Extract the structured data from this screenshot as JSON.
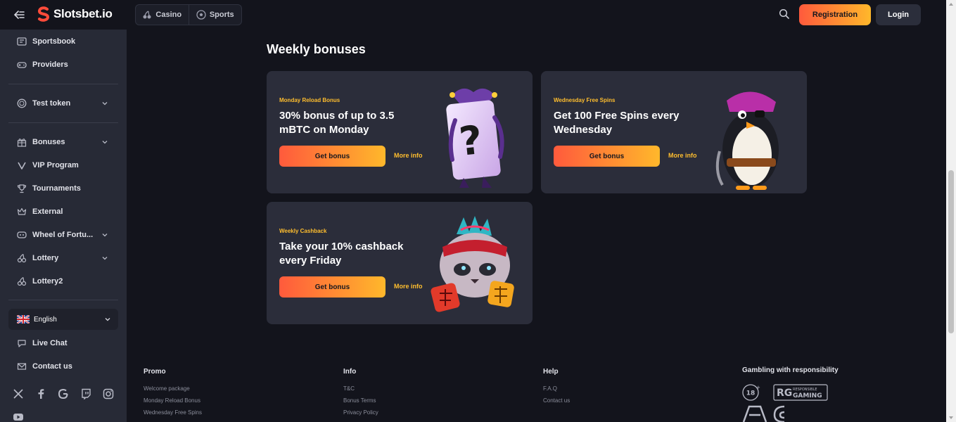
{
  "header": {
    "logo_text": "Slotsbet.io",
    "mode_tabs": [
      {
        "label": "Casino",
        "icon": "cherries-icon"
      },
      {
        "label": "Sports",
        "icon": "soccer-ball-icon"
      }
    ],
    "registration_label": "Registration",
    "login_label": "Login",
    "accent_gradient": [
      "#ff5a3c",
      "#ffb82b"
    ]
  },
  "sidebar": {
    "items": [
      {
        "label": "Sportsbook",
        "icon": "sportsbook-icon"
      },
      {
        "label": "Providers",
        "icon": "gamepad-icon"
      },
      {
        "label": "Test token",
        "icon": "token-icon",
        "expandable": true
      },
      {
        "label": "Bonuses",
        "icon": "gift-icon",
        "expandable": true
      },
      {
        "label": "VIP Program",
        "icon": "vip-icon"
      },
      {
        "label": "Tournaments",
        "icon": "trophy-icon"
      },
      {
        "label": "External",
        "icon": "crown-icon"
      },
      {
        "label": "Wheel of Fortu...",
        "icon": "wheel-icon",
        "expandable": true
      },
      {
        "label": "Lottery",
        "icon": "cherries-icon",
        "expandable": true
      },
      {
        "label": "Lottery2",
        "icon": "cherries-icon"
      }
    ],
    "language": "English",
    "support": [
      {
        "label": "Live Chat",
        "icon": "chat-icon"
      },
      {
        "label": "Contact us",
        "icon": "mail-icon"
      }
    ],
    "socials": [
      "x-icon",
      "facebook-icon",
      "google-icon",
      "twitch-icon",
      "instagram-icon",
      "youtube-icon"
    ]
  },
  "main": {
    "section_title": "Weekly bonuses",
    "bonuses": [
      {
        "tag": "Monday Reload Bonus",
        "title": "30% bonus of up to 3.5 mBTC on Monday",
        "button": "Get bonus",
        "more": "More info",
        "art": "joker-card-illustration"
      },
      {
        "tag": "Wednesday Free Spins",
        "title": "Get 100 Free Spins every Wednesday",
        "button": "Get bonus",
        "more": "More info",
        "art": "pirate-penguin-illustration"
      },
      {
        "tag": "Weekly Cashback",
        "title": "Take your 10% cashback every Friday",
        "button": "Get bonus",
        "more": "More info",
        "art": "tiger-dice-illustration"
      }
    ],
    "tag_color": "#ffbe2e"
  },
  "footer": {
    "columns": [
      {
        "title": "Promo",
        "links": [
          "Welcome package",
          "Monday Reload Bonus",
          "Wednesday Free Spins"
        ]
      },
      {
        "title": "Info",
        "links": [
          "T&C",
          "Bonus Terms",
          "Privacy Policy"
        ]
      },
      {
        "title": "Help",
        "links": [
          "F.A.Q",
          "Contact us"
        ]
      }
    ],
    "responsibility_title": "Gambling with responsibility",
    "age_badge": "18",
    "rg_badge_small": "RESPONSIBLE",
    "rg_badge_big": "GAMING"
  }
}
